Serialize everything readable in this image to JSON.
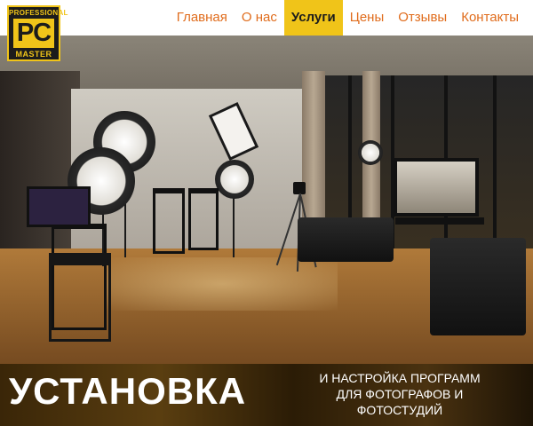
{
  "logo": {
    "top_text": "PROFESSIONAL",
    "main_text": "PC",
    "bottom_text": "MASTER"
  },
  "nav": {
    "items": [
      {
        "label": "Главная",
        "active": false
      },
      {
        "label": "О нас",
        "active": false
      },
      {
        "label": "Услуги",
        "active": true
      },
      {
        "label": "Цены",
        "active": false
      },
      {
        "label": "Отзывы",
        "active": false
      },
      {
        "label": "Контакты",
        "active": false
      }
    ]
  },
  "banner": {
    "title": "УСТАНОВКА",
    "subtitle_line1": "И НАСТРОЙКА ПРОГРАММ",
    "subtitle_line2": "ДЛЯ ФОТОГРАФОВ И",
    "subtitle_line3": "ФОТОСТУДИЙ"
  },
  "colors": {
    "accent": "#f0c419",
    "nav_text": "#e06c1c",
    "logo_bg": "#1c1c1c"
  },
  "scene": {
    "description_icon": "photo-studio-image"
  }
}
